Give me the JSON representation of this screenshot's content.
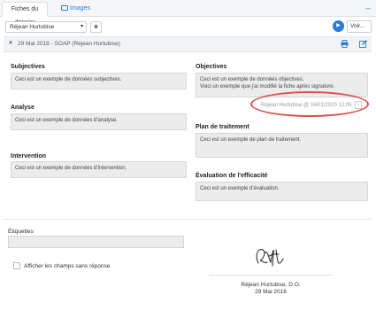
{
  "tabs": [
    {
      "label": "Fiches du dossier",
      "active": true
    },
    {
      "label": "Images",
      "active": false
    }
  ],
  "toolbar": {
    "patient_select": "Réjean Hurtubise",
    "add_label": "+",
    "voir_label": "Voir..."
  },
  "note": {
    "header": "29 Mai 2018 - SOAP (Réjean Hurtubise)",
    "sections": {
      "subjectives": {
        "label": "Subjectives",
        "value": "Ceci est un exemple de données subjectives."
      },
      "analyse": {
        "label": "Analyse",
        "value": "Ceci est un exemple de données d'analyse."
      },
      "intervention": {
        "label": "Intervention",
        "value": "Ceci est un exemple de données d'intervention."
      },
      "objectives": {
        "label": "Objectives",
        "value_line1": "Ceci est un exemple de données objectives.",
        "value_line2": "Voici un exemple que j'ai modifié la fiche après signature."
      },
      "plan": {
        "label": "Plan de traitement",
        "value": "Ceci est un exemple de plan de traitement."
      },
      "evaluation": {
        "label": "Évaluation de l'efficacité",
        "value": "Ceci est un exemple d'évaluation."
      }
    },
    "signer_stamp": "Réjean Hurtubise @ 24/01/2020 12:05",
    "tags_label": "Étiquettes",
    "show_empty_label": "Afficher les champs sans réponse",
    "signature_name": "Réjean Hurtubise, D.O.",
    "signature_date": "29 Mai 2018"
  },
  "colors": {
    "accent": "#2b7bd8",
    "highlight": "#d9534f",
    "field_bg": "#ececec"
  },
  "icons": [
    "images-icon",
    "expand-icon",
    "play-icon",
    "chevron-down-icon",
    "print-icon",
    "edit-icon",
    "info-icon"
  ]
}
